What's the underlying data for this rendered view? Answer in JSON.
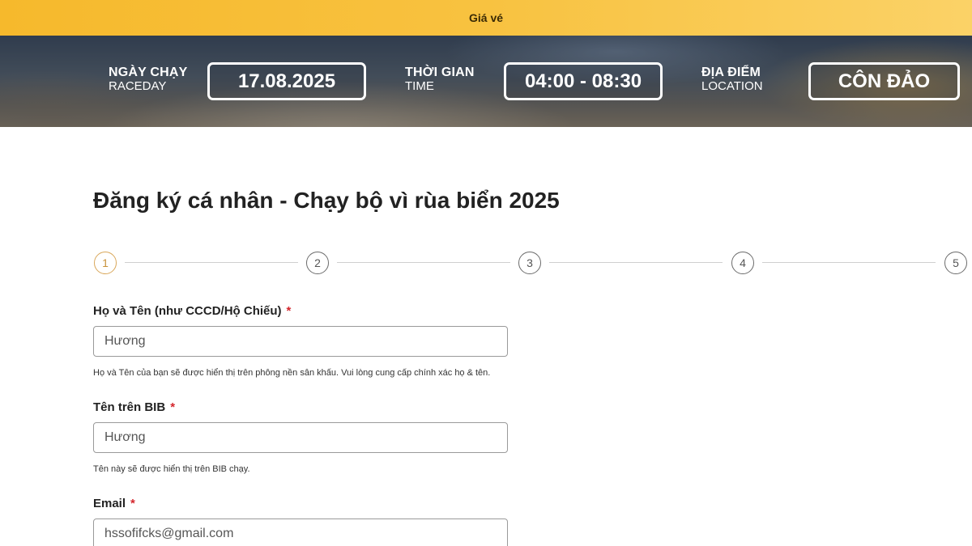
{
  "topbar": {
    "label": "Giá vé"
  },
  "event_info": {
    "raceday": {
      "label_vi": "NGÀY CHẠY",
      "label_en": "RACEDAY",
      "value": "17.08.2025"
    },
    "time": {
      "label_vi": "THỜI GIAN",
      "label_en": "TIME",
      "value": "04:00 - 08:30"
    },
    "location": {
      "label_vi": "ĐỊA ĐIỂM",
      "label_en": "LOCATION",
      "value": "CÔN ĐẢO"
    }
  },
  "form": {
    "title": "Đăng ký cá nhân - Chạy bộ vì rùa biển 2025",
    "steps": [
      "1",
      "2",
      "3",
      "4",
      "5"
    ],
    "active_step": 1,
    "required_mark": "*",
    "fields": {
      "full_name": {
        "label": "Họ và Tên (như CCCD/Hộ Chiếu)",
        "value": "Hương",
        "help": "Họ và Tên của bạn sẽ được hiển thị trên phông nền sân khấu. Vui lòng cung cấp chính xác họ & tên."
      },
      "bib_name": {
        "label": "Tên trên BIB",
        "value": "Hương",
        "help": "Tên này sẽ được hiển thị trên BIB chạy."
      },
      "email": {
        "label": "Email",
        "value": "hssofifcks@gmail.com"
      }
    }
  },
  "colors": {
    "accent": "#f6b92c",
    "required": "#d4262c",
    "active_step": "#d9a75a"
  }
}
